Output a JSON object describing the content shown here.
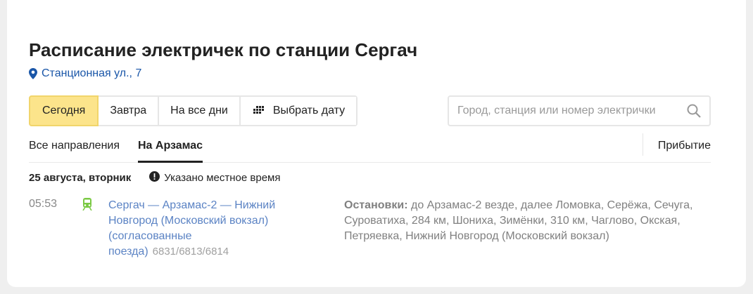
{
  "header": {
    "title": "Расписание электричек по станции Сергач",
    "address": "Станционная ул., 7"
  },
  "date_tabs": [
    {
      "label": "Сегодня",
      "active": true
    },
    {
      "label": "Завтра"
    },
    {
      "label": "На все дни"
    },
    {
      "label": "Выбрать дату",
      "icon": "calendar-icon"
    }
  ],
  "search": {
    "placeholder": "Город, станция или номер электрички",
    "value": ""
  },
  "direction_tabs": [
    {
      "label": "Все направления"
    },
    {
      "label": "На Арзамас",
      "active": true
    }
  ],
  "arrival_label": "Прибытие",
  "schedule": {
    "date": "25 августа, вторник",
    "note": "Указано местное время",
    "trains": [
      {
        "time": "05:53",
        "route": "Сергач — Арзамас-2 — Нижний Новгород (Московский вокзал) (согласованные поезда)",
        "number": "6831/6813/6814",
        "stops_label": "Остановки:",
        "stops": " до Арзамас-2 везде, далее Ломовка, Серёжа, Сечуга, Суроватиха, 284 км, Шониха, Зимёнки, 310 км, Чаглово, Окская, Петряевка, Нижний Новгород (Московский вокзал)"
      }
    ]
  },
  "colors": {
    "accent_yellow": "#fce48b",
    "link_blue": "#1a56a8",
    "route_blue": "#5b83c4",
    "train_green": "#7ac943"
  }
}
